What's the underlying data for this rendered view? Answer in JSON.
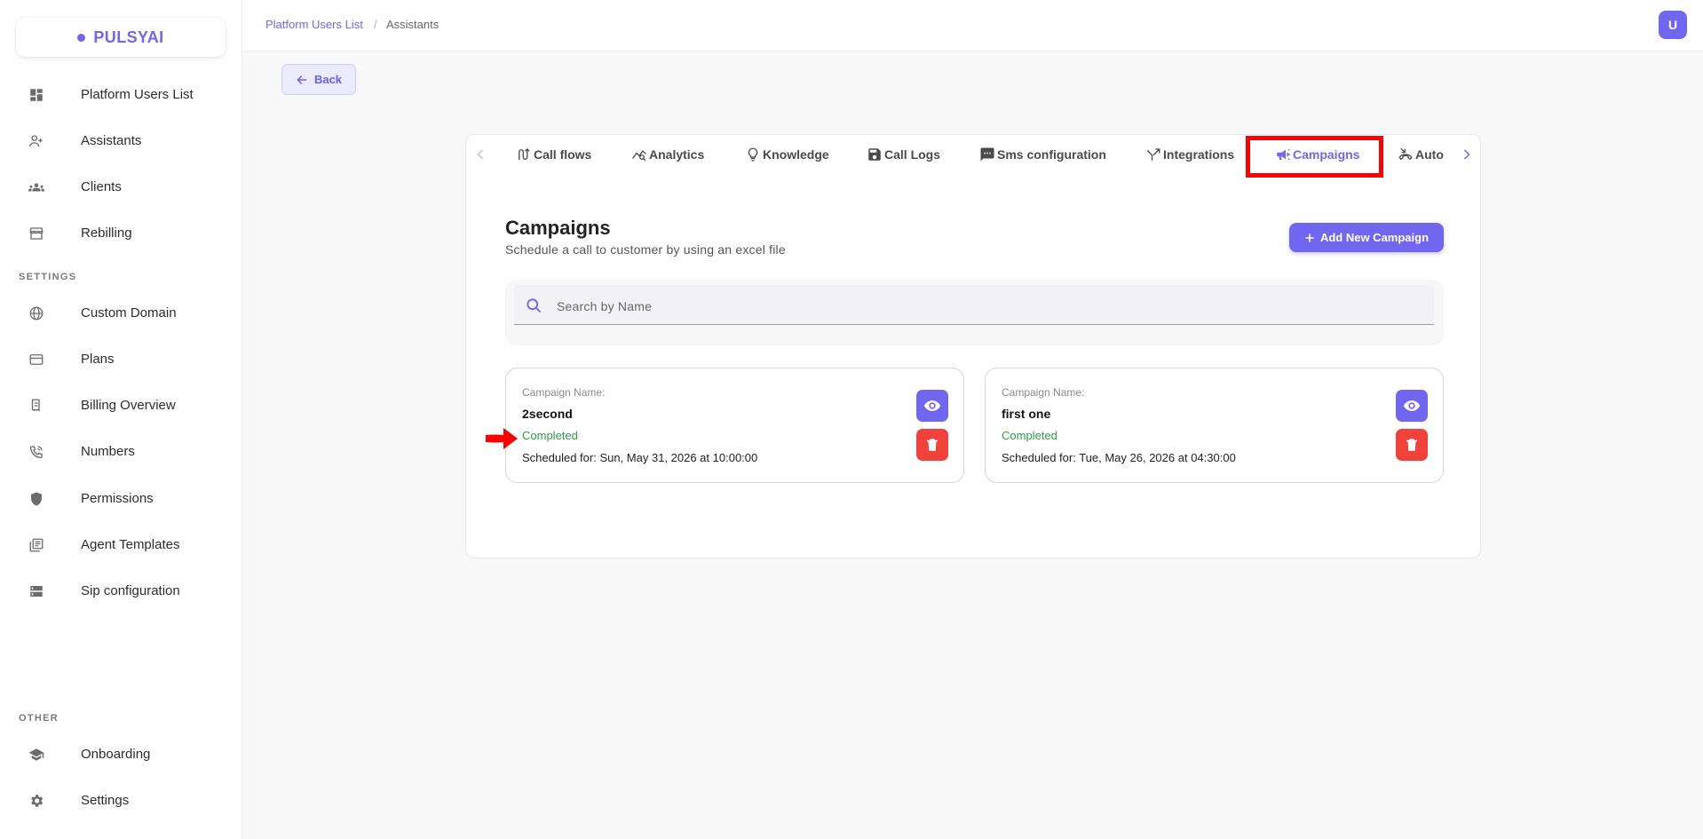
{
  "sidebar": {
    "logo": "PULSYAI",
    "main_items": [
      {
        "label": "Platform Users List",
        "icon": "dashboard-icon"
      },
      {
        "label": "Assistants",
        "icon": "person-add-icon"
      },
      {
        "label": "Clients",
        "icon": "groups-icon"
      },
      {
        "label": "Rebilling",
        "icon": "store-icon"
      }
    ],
    "settings_label": "SETTINGS",
    "settings_items": [
      {
        "label": "Custom Domain",
        "icon": "globe-icon"
      },
      {
        "label": "Plans",
        "icon": "credit-card-icon"
      },
      {
        "label": "Billing Overview",
        "icon": "receipt-icon"
      },
      {
        "label": "Numbers",
        "icon": "phone-icon"
      },
      {
        "label": "Permissions",
        "icon": "shield-icon"
      },
      {
        "label": "Agent Templates",
        "icon": "library-icon"
      },
      {
        "label": "Sip configuration",
        "icon": "server-icon"
      }
    ],
    "other_label": "OTHER",
    "other_items": [
      {
        "label": "Onboarding",
        "icon": "graduation-cap-icon"
      },
      {
        "label": "Settings",
        "icon": "gear-icon"
      }
    ]
  },
  "topbar": {
    "breadcrumb_link": "Platform Users List",
    "breadcrumb_sep": "/",
    "breadcrumb_current": "Assistants",
    "avatar_initial": "U"
  },
  "back_label": "Back",
  "tabs": [
    {
      "label": "Call flows",
      "icon": "flow-icon"
    },
    {
      "label": "Analytics",
      "icon": "analytics-icon"
    },
    {
      "label": "Knowledge",
      "icon": "lightbulb-icon"
    },
    {
      "label": "Call Logs",
      "icon": "save-icon"
    },
    {
      "label": "Sms configuration",
      "icon": "sms-icon"
    },
    {
      "label": "Integrations",
      "icon": "merge-icon"
    },
    {
      "label": "Campaigns",
      "icon": "megaphone-icon",
      "active": true
    },
    {
      "label": "Auto C",
      "icon": "phone-callback-icon"
    }
  ],
  "campaigns": {
    "title": "Campaigns",
    "subtitle": "Schedule a call to customer by using an excel file",
    "add_button": "Add New Campaign",
    "search_placeholder": "Search by Name",
    "cards": [
      {
        "label": "Campaign Name:",
        "name": "2second",
        "status": "Completed",
        "scheduled": "Scheduled for: Sun, May 31, 2026 at 10:00:00"
      },
      {
        "label": "Campaign Name:",
        "name": "first one",
        "status": "Completed",
        "scheduled": "Scheduled for: Tue, May 26, 2026 at 04:30:00"
      }
    ]
  },
  "colors": {
    "accent": "#7166f0",
    "status_completed": "#2e9e44",
    "delete": "#f0413a",
    "annotation": "#ff0000"
  }
}
